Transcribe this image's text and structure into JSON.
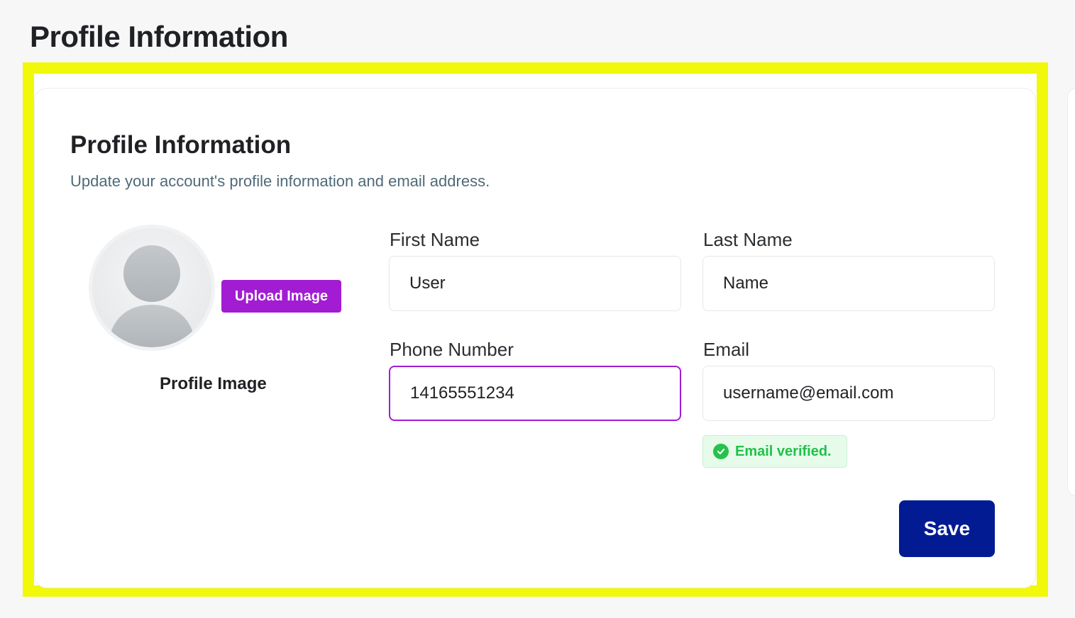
{
  "page": {
    "title": "Profile Information"
  },
  "card": {
    "title": "Profile Information",
    "subtitle": "Update your account's profile information and email address."
  },
  "avatar": {
    "upload_label": "Upload Image",
    "caption": "Profile Image"
  },
  "fields": {
    "first_name": {
      "label": "First Name",
      "value": "User"
    },
    "last_name": {
      "label": "Last Name",
      "value": "Name"
    },
    "phone": {
      "label": "Phone Number",
      "value": "14165551234"
    },
    "email": {
      "label": "Email",
      "value": "username@email.com"
    }
  },
  "email_status": {
    "text": "Email verified.",
    "icon": "check-circle-icon"
  },
  "actions": {
    "save_label": "Save"
  },
  "colors": {
    "highlight": "#f1f80a",
    "upload_button": "#a21cd3",
    "focus_border": "#a21cd3",
    "save_button": "#021b93",
    "verified_text": "#22c04a",
    "verified_background": "#e6fbea"
  }
}
